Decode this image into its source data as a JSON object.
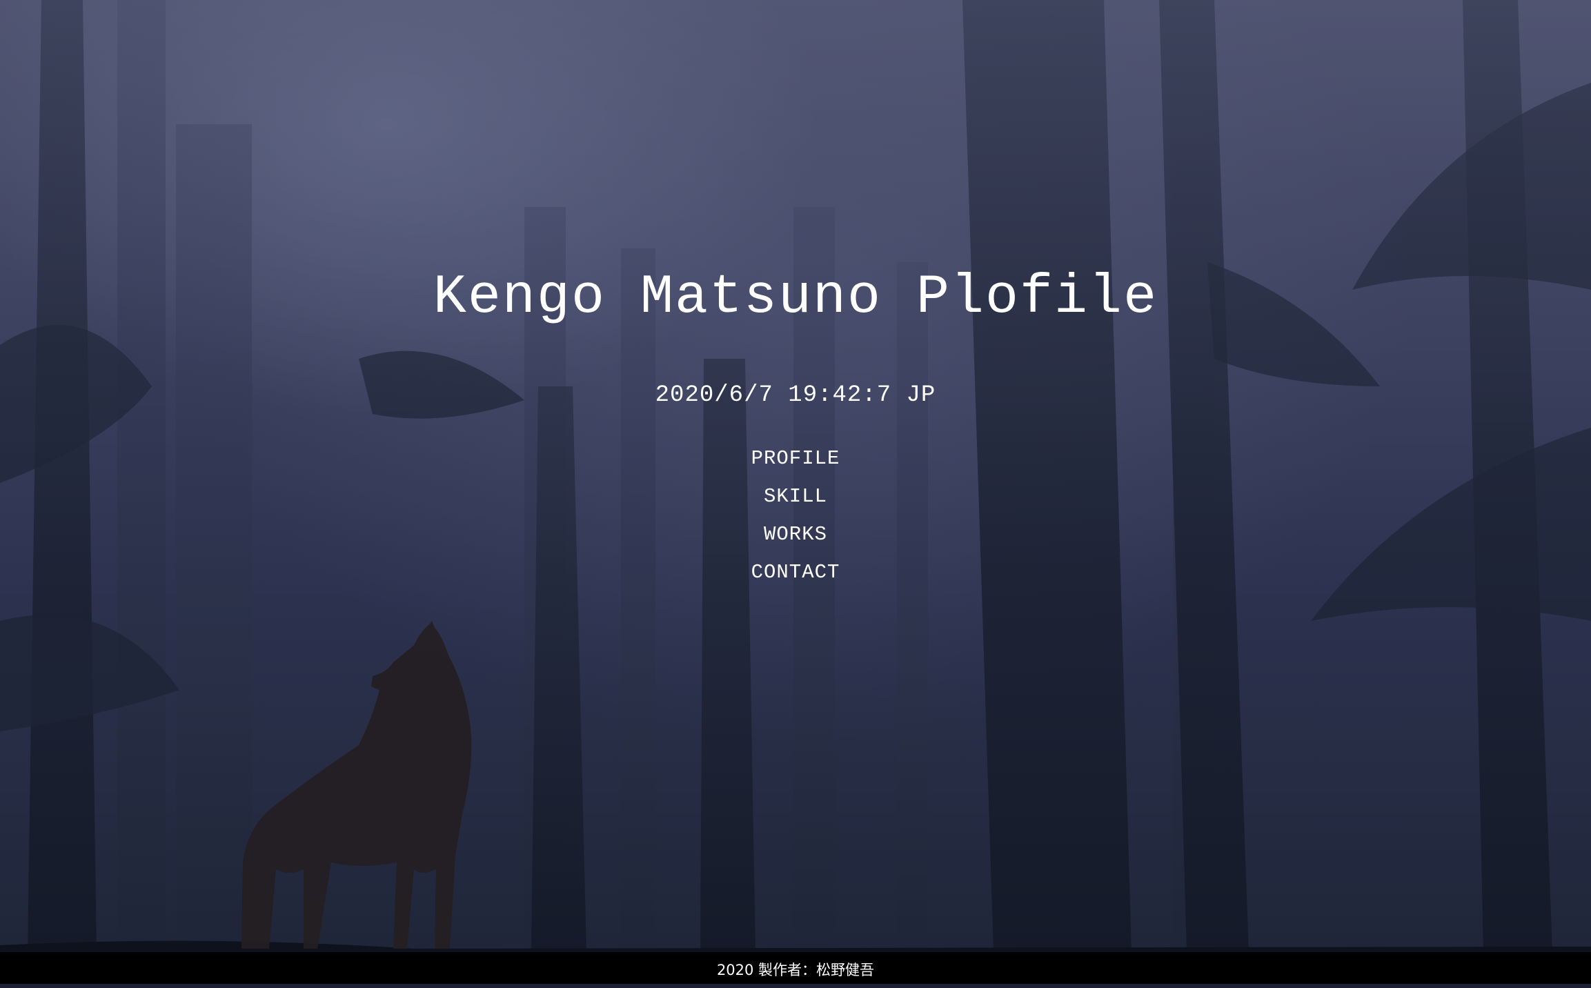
{
  "header": {
    "title": "Kengo Matsuno Plofile",
    "datetime": "2020/6/7 19:42:7 JP"
  },
  "nav": {
    "items": [
      {
        "label": "PROFILE"
      },
      {
        "label": "SKILL"
      },
      {
        "label": "WORKS"
      },
      {
        "label": "CONTACT"
      }
    ]
  },
  "footer": {
    "text": "2020 製作者：松野健吾"
  },
  "colors": {
    "text": "#ffffff",
    "footer_bg": "#000000",
    "background": "#2d3350"
  }
}
